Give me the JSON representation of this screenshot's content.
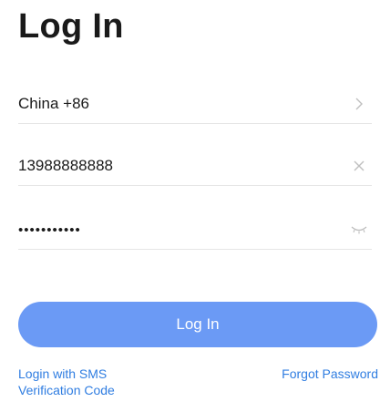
{
  "title": "Log In",
  "country": {
    "value": "China +86",
    "trail_icon": "chevron-right-icon"
  },
  "phone": {
    "value": "13988888888",
    "trail_icon": "clear-icon"
  },
  "password": {
    "value": "•••••••••••",
    "trail_icon": "eye-closed-icon"
  },
  "login_button": "Log In",
  "links": {
    "sms_login": "Login with SMS Verification Code",
    "forgot_password": "Forgot Password"
  },
  "colors": {
    "primary_button": "#6b9af5",
    "link": "#2f7de1",
    "divider": "#e6e6e6",
    "icon_gray": "#bfbfbf"
  }
}
